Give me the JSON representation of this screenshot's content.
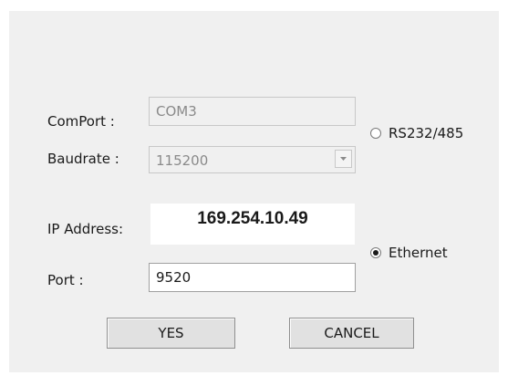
{
  "dialog": {
    "com_port": {
      "label": "ComPort :",
      "value": "COM3",
      "enabled": false
    },
    "baudrate": {
      "label": "Baudrate :",
      "value": "115200",
      "enabled": false
    },
    "ip_address": {
      "label": "IP Address:",
      "value": "169.254.10.49"
    },
    "port": {
      "label": "Port :",
      "value": "9520"
    },
    "radio_serial": {
      "label": "RS232/485",
      "checked": false
    },
    "radio_ethernet": {
      "label": "Ethernet",
      "checked": true
    },
    "buttons": {
      "yes_label": "YES",
      "cancel_label": "CANCEL"
    }
  }
}
